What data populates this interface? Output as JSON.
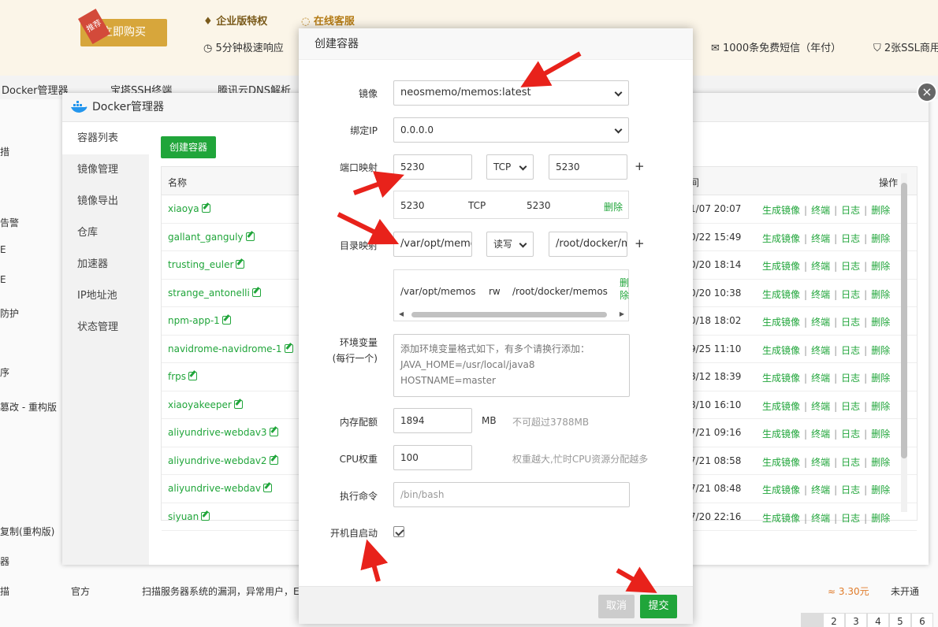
{
  "topbar": {
    "buy_label": "立即购买",
    "badge": "推荐",
    "enterprise": "企业版特权",
    "service": "在线客服",
    "fast_response": "5分钟极速响应",
    "sms": "1000条免费短信（年付）",
    "ssl": "2张SSL商用"
  },
  "tabs": [
    "Docker管理器",
    "宝塔SSH终端",
    "腾讯云DNS解析"
  ],
  "background_rows": [
    "措",
    "告警",
    "E",
    "E",
    "防护",
    "序",
    "篡改 - 重构版",
    "复制(重构版)",
    "器",
    "描"
  ],
  "bottom_row": {
    "source": "官方",
    "desc": "扫描服务器系统的漏洞，异常用户，E",
    "price": "≈ 3.30元",
    "status": "未开通"
  },
  "pager": [
    "2",
    "3",
    "4",
    "5",
    "6"
  ],
  "docker": {
    "title": "Docker管理器",
    "sidebar": [
      "容器列表",
      "镜像管理",
      "镜像导出",
      "仓库",
      "加速器",
      "IP地址池",
      "状态管理"
    ],
    "create_button": "创建容器",
    "col_name": "名称",
    "col_time": "间",
    "col_ops": "操作",
    "ops": [
      "生成镜像",
      "终端",
      "日志",
      "删除"
    ],
    "containers": [
      {
        "name": "xiaoya",
        "time": "1/07 20:07"
      },
      {
        "name": "gallant_ganguly",
        "time": "0/22 15:49"
      },
      {
        "name": "trusting_euler",
        "time": "0/20 18:14"
      },
      {
        "name": "strange_antonelli",
        "time": "0/20 10:38"
      },
      {
        "name": "npm-app-1",
        "time": "0/18 18:02"
      },
      {
        "name": "navidrome-navidrome-1",
        "time": "9/25 11:10"
      },
      {
        "name": "frps",
        "time": "8/12 18:39"
      },
      {
        "name": "xiaoyakeeper",
        "time": "8/10 16:10"
      },
      {
        "name": "aliyundrive-webdav3",
        "time": "7/21 09:16"
      },
      {
        "name": "aliyundrive-webdav2",
        "time": "7/21 08:58"
      },
      {
        "name": "aliyundrive-webdav",
        "time": "7/21 08:48"
      },
      {
        "name": "siyuan",
        "time": "7/20 22:16"
      }
    ]
  },
  "modal": {
    "title": "创建容器",
    "image_label": "镜像",
    "image_value": "neosmemo/memos:latest",
    "ip_label": "绑定IP",
    "ip_value": "0.0.0.0",
    "port_label": "端口映射",
    "port_host": "5230",
    "port_proto": "TCP",
    "port_container": "5230",
    "port_row": {
      "host": "5230",
      "proto": "TCP",
      "container": "5230",
      "delete": "删除"
    },
    "dir_label": "目录映射",
    "dir_host": "/var/opt/memo",
    "dir_mode": "读写",
    "dir_container": "/root/docker/m",
    "dir_row": {
      "host": "/var/opt/memos",
      "mode": "rw",
      "container": "/root/docker/memos",
      "delete": "删除"
    },
    "env_label": "环境变量",
    "env_label2": "(每行一个)",
    "env_placeholder_1": "添加环境变量格式如下，有多个请换行添加：",
    "env_placeholder_2": "JAVA_HOME=/usr/local/java8",
    "env_placeholder_3": "HOSTNAME=master",
    "mem_label": "内存配额",
    "mem_value": "1894",
    "mem_unit": "MB",
    "mem_hint": "不可超过3788MB",
    "cpu_label": "CPU权重",
    "cpu_value": "100",
    "cpu_hint": "权重越大,忙时CPU资源分配越多",
    "cmd_label": "执行命令",
    "cmd_placeholder": "/bin/bash",
    "autostart_label": "开机自启动",
    "autostart_checked": true,
    "plus": "+",
    "cancel": "取消",
    "submit": "提交"
  },
  "colors": {
    "accent": "#20a53a",
    "arrow": "#e8221b",
    "buy": "#d7a63b"
  }
}
